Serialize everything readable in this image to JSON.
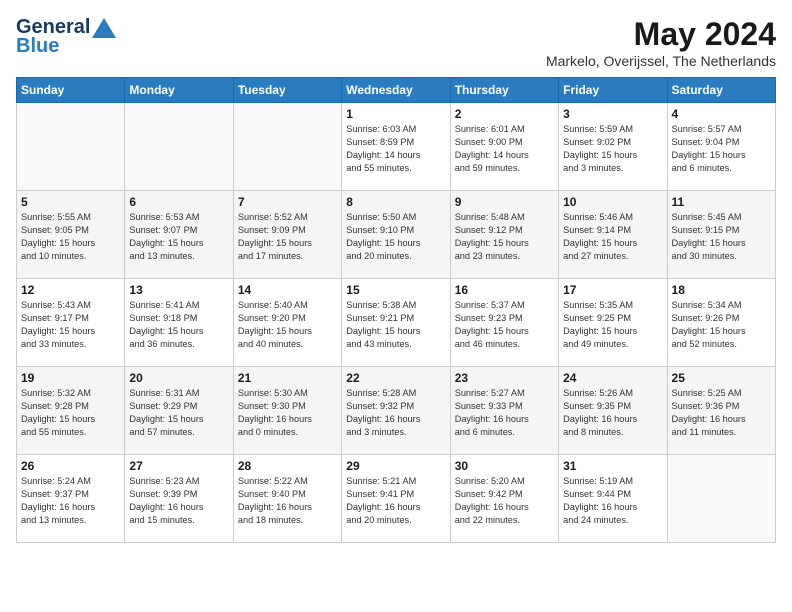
{
  "logo": {
    "general": "General",
    "blue": "Blue"
  },
  "header": {
    "title": "May 2024",
    "subtitle": "Markelo, Overijssel, The Netherlands"
  },
  "weekdays": [
    "Sunday",
    "Monday",
    "Tuesday",
    "Wednesday",
    "Thursday",
    "Friday",
    "Saturday"
  ],
  "weeks": [
    [
      {
        "day": "",
        "info": ""
      },
      {
        "day": "",
        "info": ""
      },
      {
        "day": "",
        "info": ""
      },
      {
        "day": "1",
        "info": "Sunrise: 6:03 AM\nSunset: 8:59 PM\nDaylight: 14 hours\nand 55 minutes."
      },
      {
        "day": "2",
        "info": "Sunrise: 6:01 AM\nSunset: 9:00 PM\nDaylight: 14 hours\nand 59 minutes."
      },
      {
        "day": "3",
        "info": "Sunrise: 5:59 AM\nSunset: 9:02 PM\nDaylight: 15 hours\nand 3 minutes."
      },
      {
        "day": "4",
        "info": "Sunrise: 5:57 AM\nSunset: 9:04 PM\nDaylight: 15 hours\nand 6 minutes."
      }
    ],
    [
      {
        "day": "5",
        "info": "Sunrise: 5:55 AM\nSunset: 9:05 PM\nDaylight: 15 hours\nand 10 minutes."
      },
      {
        "day": "6",
        "info": "Sunrise: 5:53 AM\nSunset: 9:07 PM\nDaylight: 15 hours\nand 13 minutes."
      },
      {
        "day": "7",
        "info": "Sunrise: 5:52 AM\nSunset: 9:09 PM\nDaylight: 15 hours\nand 17 minutes."
      },
      {
        "day": "8",
        "info": "Sunrise: 5:50 AM\nSunset: 9:10 PM\nDaylight: 15 hours\nand 20 minutes."
      },
      {
        "day": "9",
        "info": "Sunrise: 5:48 AM\nSunset: 9:12 PM\nDaylight: 15 hours\nand 23 minutes."
      },
      {
        "day": "10",
        "info": "Sunrise: 5:46 AM\nSunset: 9:14 PM\nDaylight: 15 hours\nand 27 minutes."
      },
      {
        "day": "11",
        "info": "Sunrise: 5:45 AM\nSunset: 9:15 PM\nDaylight: 15 hours\nand 30 minutes."
      }
    ],
    [
      {
        "day": "12",
        "info": "Sunrise: 5:43 AM\nSunset: 9:17 PM\nDaylight: 15 hours\nand 33 minutes."
      },
      {
        "day": "13",
        "info": "Sunrise: 5:41 AM\nSunset: 9:18 PM\nDaylight: 15 hours\nand 36 minutes."
      },
      {
        "day": "14",
        "info": "Sunrise: 5:40 AM\nSunset: 9:20 PM\nDaylight: 15 hours\nand 40 minutes."
      },
      {
        "day": "15",
        "info": "Sunrise: 5:38 AM\nSunset: 9:21 PM\nDaylight: 15 hours\nand 43 minutes."
      },
      {
        "day": "16",
        "info": "Sunrise: 5:37 AM\nSunset: 9:23 PM\nDaylight: 15 hours\nand 46 minutes."
      },
      {
        "day": "17",
        "info": "Sunrise: 5:35 AM\nSunset: 9:25 PM\nDaylight: 15 hours\nand 49 minutes."
      },
      {
        "day": "18",
        "info": "Sunrise: 5:34 AM\nSunset: 9:26 PM\nDaylight: 15 hours\nand 52 minutes."
      }
    ],
    [
      {
        "day": "19",
        "info": "Sunrise: 5:32 AM\nSunset: 9:28 PM\nDaylight: 15 hours\nand 55 minutes."
      },
      {
        "day": "20",
        "info": "Sunrise: 5:31 AM\nSunset: 9:29 PM\nDaylight: 15 hours\nand 57 minutes."
      },
      {
        "day": "21",
        "info": "Sunrise: 5:30 AM\nSunset: 9:30 PM\nDaylight: 16 hours\nand 0 minutes."
      },
      {
        "day": "22",
        "info": "Sunrise: 5:28 AM\nSunset: 9:32 PM\nDaylight: 16 hours\nand 3 minutes."
      },
      {
        "day": "23",
        "info": "Sunrise: 5:27 AM\nSunset: 9:33 PM\nDaylight: 16 hours\nand 6 minutes."
      },
      {
        "day": "24",
        "info": "Sunrise: 5:26 AM\nSunset: 9:35 PM\nDaylight: 16 hours\nand 8 minutes."
      },
      {
        "day": "25",
        "info": "Sunrise: 5:25 AM\nSunset: 9:36 PM\nDaylight: 16 hours\nand 11 minutes."
      }
    ],
    [
      {
        "day": "26",
        "info": "Sunrise: 5:24 AM\nSunset: 9:37 PM\nDaylight: 16 hours\nand 13 minutes."
      },
      {
        "day": "27",
        "info": "Sunrise: 5:23 AM\nSunset: 9:39 PM\nDaylight: 16 hours\nand 15 minutes."
      },
      {
        "day": "28",
        "info": "Sunrise: 5:22 AM\nSunset: 9:40 PM\nDaylight: 16 hours\nand 18 minutes."
      },
      {
        "day": "29",
        "info": "Sunrise: 5:21 AM\nSunset: 9:41 PM\nDaylight: 16 hours\nand 20 minutes."
      },
      {
        "day": "30",
        "info": "Sunrise: 5:20 AM\nSunset: 9:42 PM\nDaylight: 16 hours\nand 22 minutes."
      },
      {
        "day": "31",
        "info": "Sunrise: 5:19 AM\nSunset: 9:44 PM\nDaylight: 16 hours\nand 24 minutes."
      },
      {
        "day": "",
        "info": ""
      }
    ]
  ]
}
